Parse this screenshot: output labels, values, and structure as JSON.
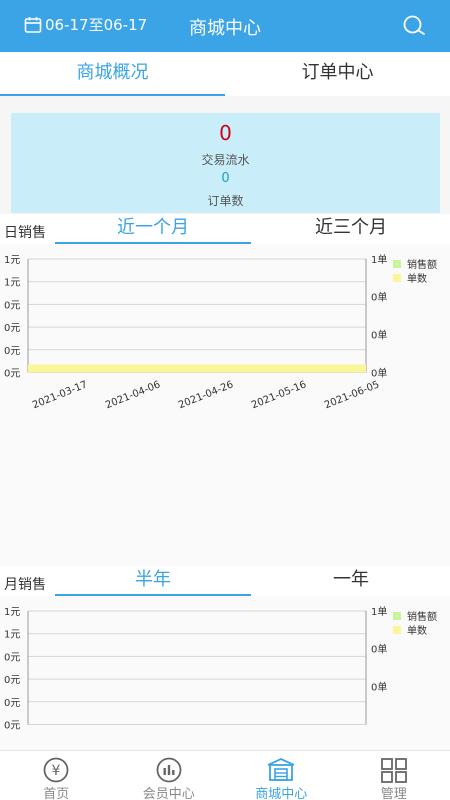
{
  "header": {
    "date_range": "06-17至06-17",
    "title": "商城中心"
  },
  "tabs": [
    {
      "label": "商城概况",
      "active": true
    },
    {
      "label": "订单中心",
      "active": false
    }
  ],
  "stats": {
    "amount": "0",
    "amount_label": "交易流水",
    "orders": "0",
    "orders_label": "订单数"
  },
  "daily": {
    "label": "日销售",
    "segments": [
      "近一个月",
      "近三个月"
    ]
  },
  "monthly": {
    "label": "月销售",
    "segments": [
      "半年",
      "一年"
    ]
  },
  "colors": {
    "accent": "#3aa4e6",
    "sales_series": "#c6f59a",
    "orders_series": "#fbf69a"
  },
  "chart_data": [
    {
      "type": "bar",
      "x": [
        "2021-03-17",
        "2021-04-06",
        "2021-04-26",
        "2021-05-16",
        "2021-06-05"
      ],
      "y_left_ticks": [
        "1元",
        "1元",
        "0元",
        "0元",
        "0元",
        "0元"
      ],
      "y_right_ticks": [
        "1单",
        "0单",
        "0单",
        "0单"
      ],
      "series": [
        {
          "name": "销售额",
          "values": [
            0,
            0,
            0,
            0,
            0
          ]
        },
        {
          "name": "单数",
          "values": [
            0,
            0,
            0,
            0,
            0
          ]
        }
      ],
      "legend": "top-right",
      "grid": true
    },
    {
      "type": "bar",
      "x": [],
      "y_left_ticks": [
        "1元",
        "1元",
        "0元",
        "0元",
        "0元",
        "0元"
      ],
      "y_right_ticks": [
        "1单",
        "0单",
        "0单"
      ],
      "series": [
        {
          "name": "销售额",
          "values": []
        },
        {
          "name": "单数",
          "values": []
        }
      ],
      "legend": "top-right",
      "grid": true
    }
  ],
  "bottom_nav": [
    {
      "label": "首页",
      "icon": "yen-icon",
      "active": false
    },
    {
      "label": "会员中心",
      "icon": "chart-icon",
      "active": false
    },
    {
      "label": "商城中心",
      "icon": "store-icon",
      "active": true
    },
    {
      "label": "管理",
      "icon": "grid-icon",
      "active": false
    }
  ]
}
